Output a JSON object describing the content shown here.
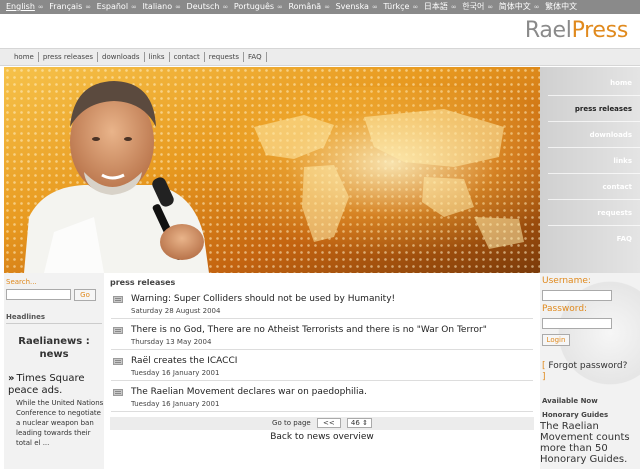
{
  "languages": {
    "items": [
      "English",
      "Français",
      "Español",
      "Italiano",
      "Deutsch",
      "Português",
      "Română",
      "Svenska",
      "Türkçe",
      "日本語",
      "한국어",
      "简体中文",
      "繁体中文"
    ],
    "separator": "∞"
  },
  "logo": {
    "part1": "Rael",
    "part2": "Press"
  },
  "nav": {
    "items": [
      "home",
      "press releases",
      "downloads",
      "links",
      "contact",
      "requests",
      "FAQ"
    ]
  },
  "sidenav": {
    "items": [
      "home",
      "press releases",
      "downloads",
      "links",
      "contact",
      "requests",
      "FAQ"
    ],
    "active": "press releases"
  },
  "search": {
    "label": "Search...",
    "value": "",
    "button": "Go"
  },
  "left": {
    "headlines_label": "Headlines",
    "news_title": "Raelianews : news",
    "item_marker": "»",
    "item_title": "Times Square peace ads.",
    "item_body": "While the United Nations Conference to negotiate a nuclear weapon ban leading towards their total el ..."
  },
  "main": {
    "title": "press releases",
    "articles": [
      {
        "title": "Warning: Super Colliders should not be used by Humanity!",
        "date": "Saturday 28 August 2004"
      },
      {
        "title": "There is no God, There are no Atheist Terrorists and there is no \"War On Terror\"",
        "date": "Thursday 13 May 2004"
      },
      {
        "title": "Raël creates the ICACCI",
        "date": "Tuesday 16 January 2001"
      },
      {
        "title": "The Raelian Movement declares war on paedophilia.",
        "date": "Tuesday 16 January 2001"
      }
    ],
    "pager": {
      "label": "Go to page",
      "prev": "<<",
      "page": "46"
    },
    "back": "Back to news overview"
  },
  "login": {
    "username_label": "Username:",
    "password_label": "Password:",
    "button": "Login",
    "forgot_open": "[",
    "forgot": " Forgot password?",
    "forgot_close": "]"
  },
  "right": {
    "available_now": "Available Now",
    "honorary_label": "Honorary Guides",
    "honorary_text": "The Raelian Movement counts more than 50 Honorary Guides."
  },
  "colors": {
    "accent": "#e08a1e",
    "langbar": "#8a8a8a",
    "hero": "#e89a20"
  }
}
